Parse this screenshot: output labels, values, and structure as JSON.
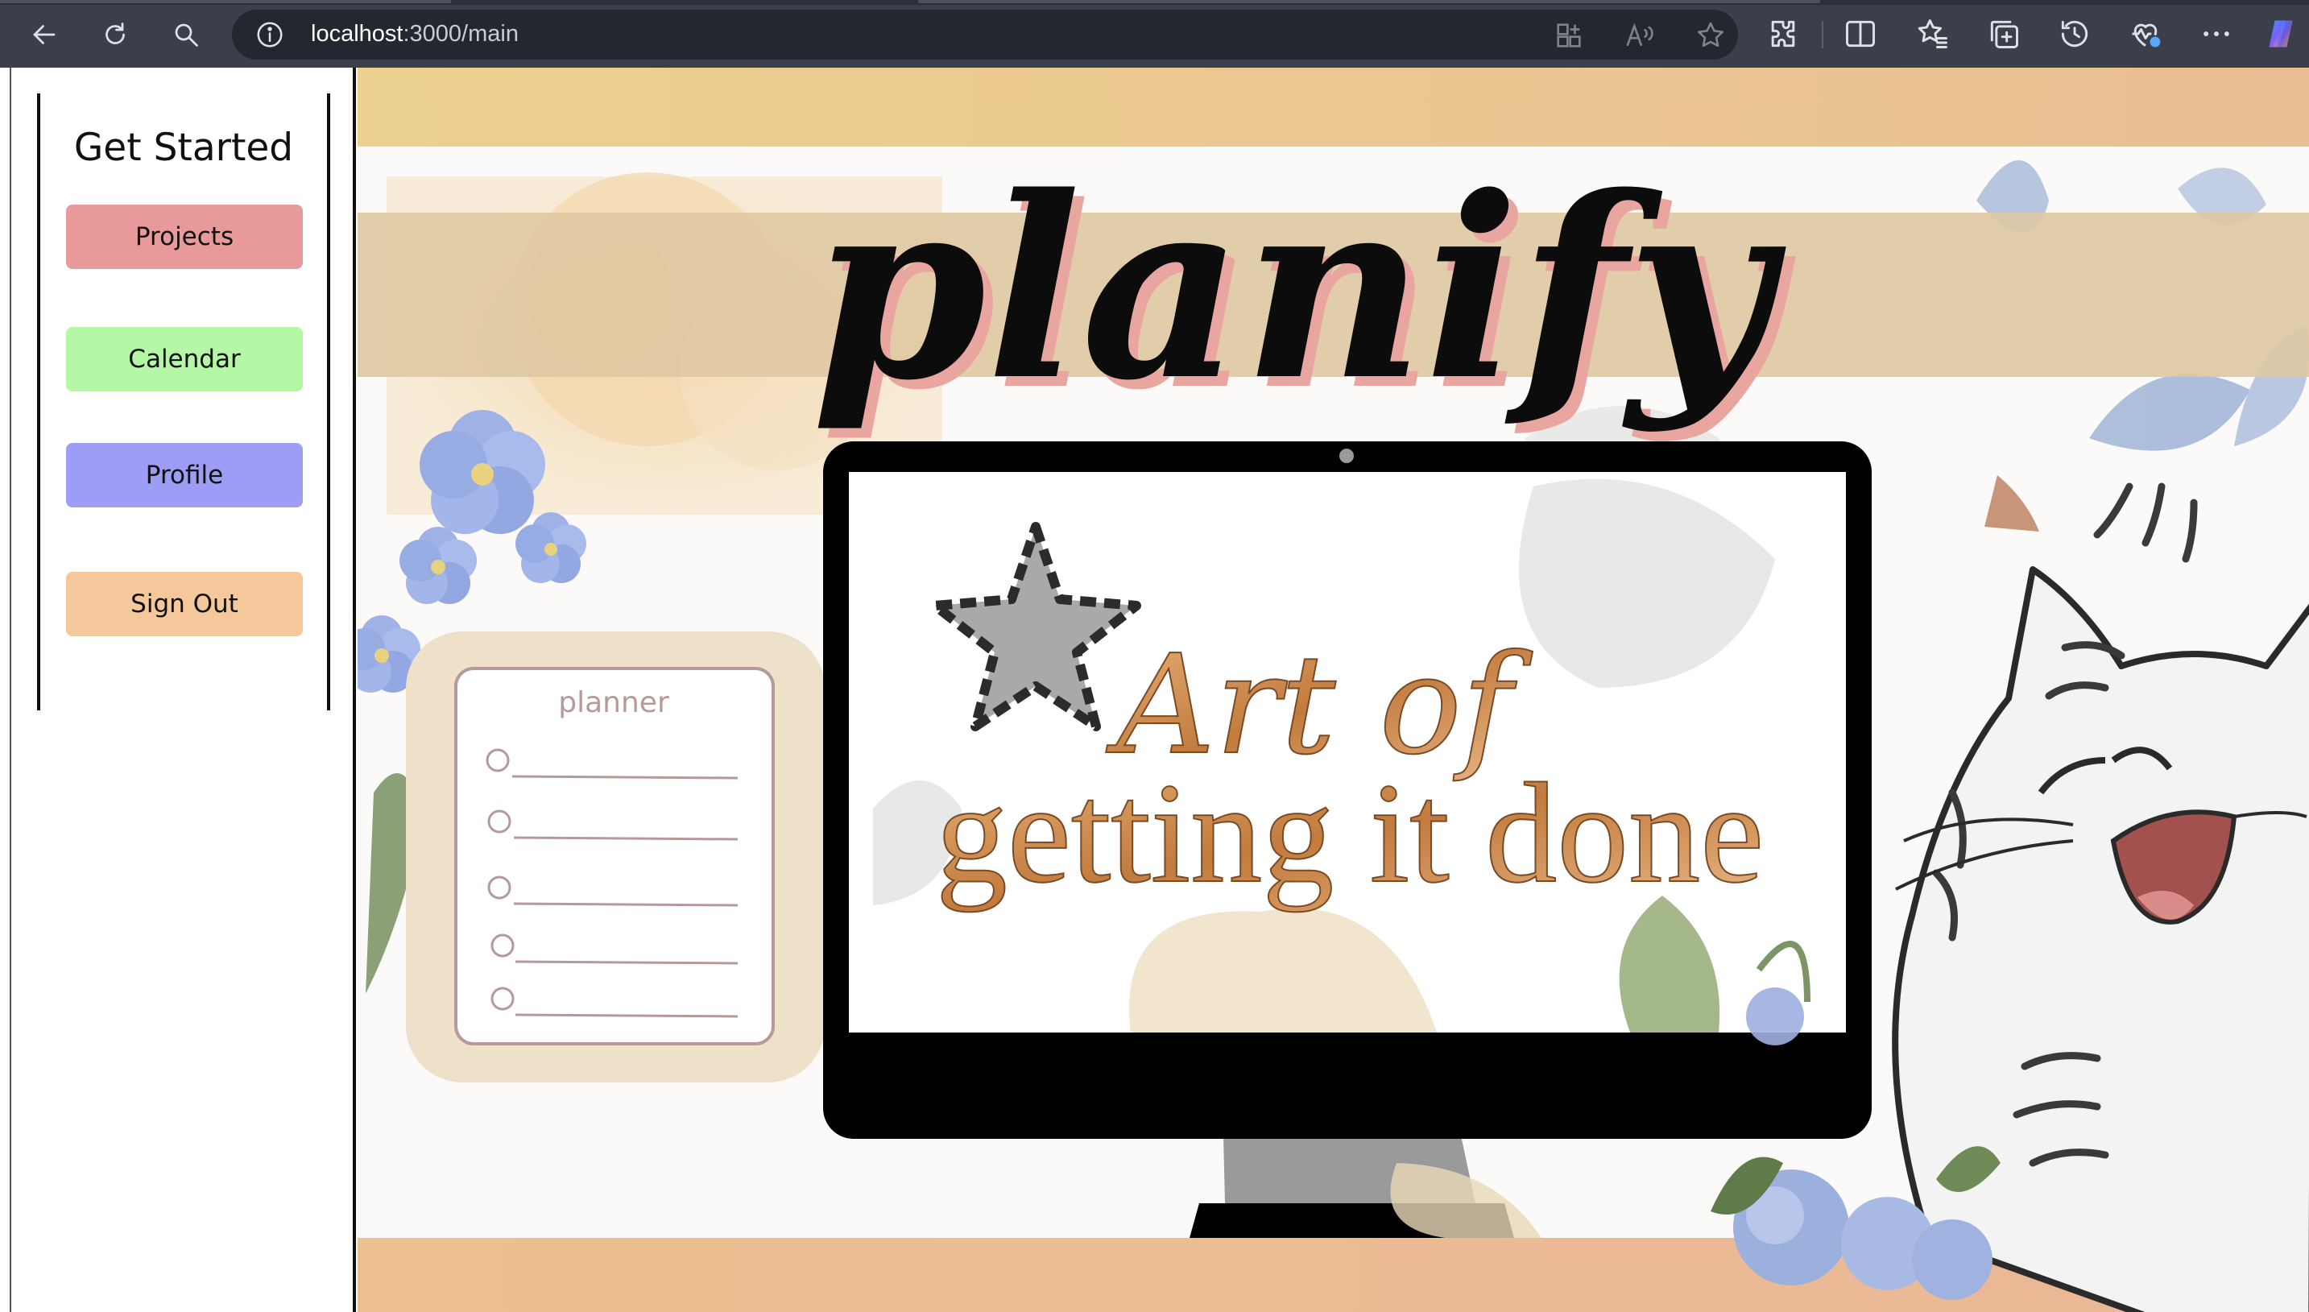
{
  "browser": {
    "url_host": "localhost",
    "url_path": ":3000/main"
  },
  "sidebar": {
    "title": "Get Started",
    "buttons": [
      {
        "label": "Projects",
        "color": "#e89a9a"
      },
      {
        "label": "Calendar",
        "color": "#b4f7a4"
      },
      {
        "label": "Profile",
        "color": "#9d9df5"
      },
      {
        "label": "Sign Out",
        "color": "#f4c89b"
      }
    ]
  },
  "hero": {
    "logo_text": "planify",
    "planner_title": "planner",
    "screen_line1": "Art of",
    "screen_line2": "getting it done"
  },
  "colors": {
    "banner_top": "#ecd08f",
    "banner_bottom": "#ecbf97",
    "logo_band": "#dfc8a2",
    "planner_bg": "#eee0c9",
    "monitor": "#000000"
  }
}
